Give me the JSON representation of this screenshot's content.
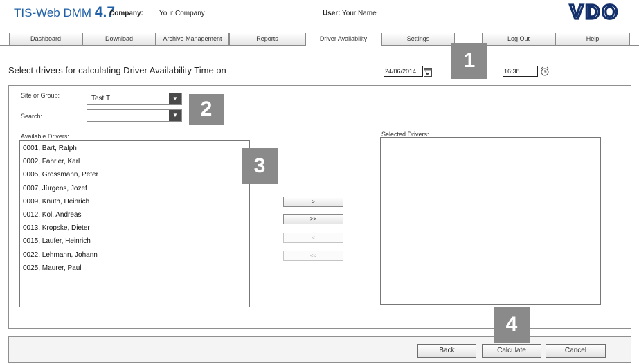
{
  "header": {
    "app_name": "TIS-Web DMM",
    "version": "4.7",
    "company_label": "Company:",
    "company_value": "Your Company",
    "user_label": "User:",
    "user_value": "Your Name",
    "logo_text": "VDO",
    "brand_color": "#1f5fa6"
  },
  "nav": {
    "tabs": [
      {
        "label": "Dashboard"
      },
      {
        "label": "Download"
      },
      {
        "label": "Archive Management"
      },
      {
        "label": "Reports"
      },
      {
        "label": "Driver Availability",
        "active": true
      },
      {
        "label": "Settings"
      },
      {
        "label": "Log Out"
      },
      {
        "label": "Help"
      }
    ]
  },
  "form": {
    "heading": "Select drivers for calculating Driver Availability Time on",
    "date": "24/06/2014",
    "time": "16:38",
    "site_label": "Site or Group:",
    "site_value": "Test T",
    "search_label": "Search:",
    "search_value": "",
    "available_label": "Available Drivers:",
    "selected_label": "Selected Drivers:"
  },
  "available_drivers": [
    "0001, Bart, Ralph",
    "0002, Fahrler, Karl",
    "0005, Grossmann, Peter",
    "0007, Jürgens, Jozef",
    "0009, Knuth, Heinrich",
    "0012, Kol, Andreas",
    "0013, Kropske, Dieter",
    "0015, Laufer, Heinrich",
    "0022, Lehmann, Johann",
    "0025, Maurer, Paul"
  ],
  "selected_drivers": [],
  "move_buttons": {
    "add": ">",
    "add_all": ">>",
    "remove": "<",
    "remove_all": "<<"
  },
  "actions": {
    "back": "Back",
    "calculate": "Calculate",
    "cancel": "Cancel"
  },
  "markers": [
    "1",
    "2",
    "3",
    "4"
  ]
}
